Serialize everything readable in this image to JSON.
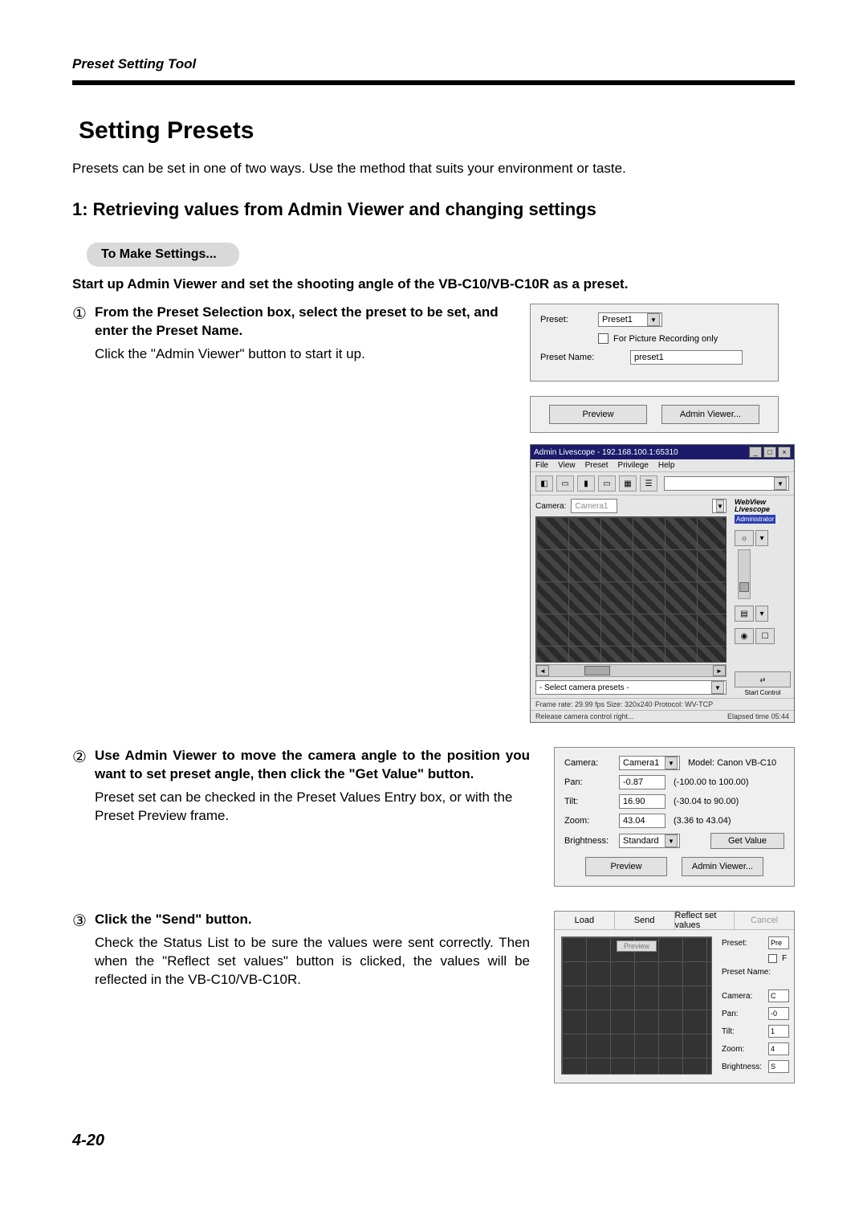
{
  "header": {
    "title": "Preset Setting Tool"
  },
  "main": {
    "title": "Setting Presets",
    "intro": "Presets can be set in one of two ways. Use the method that suits your environment or taste.",
    "section_title": "1: Retrieving values from Admin Viewer and changing settings",
    "pill": "To Make Settings...",
    "lead": "Start up Admin Viewer and set the shooting angle of the VB-C10/VB-C10R as a preset."
  },
  "steps": [
    {
      "num": "①",
      "bold": "From the Preset Selection box, select the preset to be set, and enter the Preset Name.",
      "text": "Click the \"Admin Viewer\" button to start it up."
    },
    {
      "num": "②",
      "bold": "Use Admin Viewer to move the camera angle to the position you want to set preset angle, then click the \"Get Value\" button.",
      "text": "Preset set can be checked in the Preset Values Entry box, or with the Preset Preview frame."
    },
    {
      "num": "③",
      "bold": "Click the \"Send\" button.",
      "text": "Check the Status List to be sure the values were sent correctly. Then when the \"Reflect set values\" button is clicked, the values will be reflected in the VB-C10/VB-C10R."
    }
  ],
  "panel1": {
    "preset_label": "Preset:",
    "preset_value": "Preset1",
    "checkbox_label": "For Picture Recording only",
    "name_label": "Preset Name:",
    "name_value": "preset1",
    "preview_btn": "Preview",
    "admin_btn": "Admin Viewer..."
  },
  "livescope": {
    "title": "Admin Livescope - 192.168.100.1:65310",
    "menus": [
      "File",
      "View",
      "Preset",
      "Privilege",
      "Help"
    ],
    "camera_label": "Camera:",
    "camera_value": "Camera1",
    "brand1": "WebView",
    "brand2": "Livescope",
    "admin_tag": "Administrator",
    "preset_placeholder": "- Select camera presets -",
    "start_btn": "Start Control",
    "status1_left": "Frame rate: 29.99 fps   Size: 320x240   Protocol: WV-TCP",
    "status2_left": "Release camera control right...",
    "status2_right": "Elapsed time 05:44"
  },
  "panel2": {
    "rows": [
      {
        "label": "Camera:",
        "value": "Camera1",
        "range": "Model:   Canon VB-C10",
        "dropdown": true
      },
      {
        "label": "Pan:",
        "value": "-0.87",
        "range": "(-100.00 to 100.00)"
      },
      {
        "label": "Tilt:",
        "value": "16.90",
        "range": "(-30.04 to 90.00)"
      },
      {
        "label": "Zoom:",
        "value": "43.04",
        "range": "(3.36 to 43.04)"
      },
      {
        "label": "Brightness:",
        "value": "Standard",
        "range_btn": "Get Value",
        "dropdown": true
      }
    ],
    "preview_btn": "Preview",
    "admin_btn": "Admin Viewer..."
  },
  "panel3": {
    "top_buttons": [
      "Load",
      "Send",
      "Reflect set values",
      "Cancel"
    ],
    "preview_tag": "Preview",
    "side": [
      {
        "label": "Preset:",
        "value": "Pre"
      },
      {
        "label": "",
        "value": "F",
        "checkbox": true
      },
      {
        "label": "Preset Name:",
        "value": ""
      },
      {
        "label": "Camera:",
        "value": "C"
      },
      {
        "label": "Pan:",
        "value": "-0"
      },
      {
        "label": "Tilt:",
        "value": "1"
      },
      {
        "label": "Zoom:",
        "value": "4"
      },
      {
        "label": "Brightness:",
        "value": "S"
      }
    ]
  },
  "page_number": "4-20"
}
